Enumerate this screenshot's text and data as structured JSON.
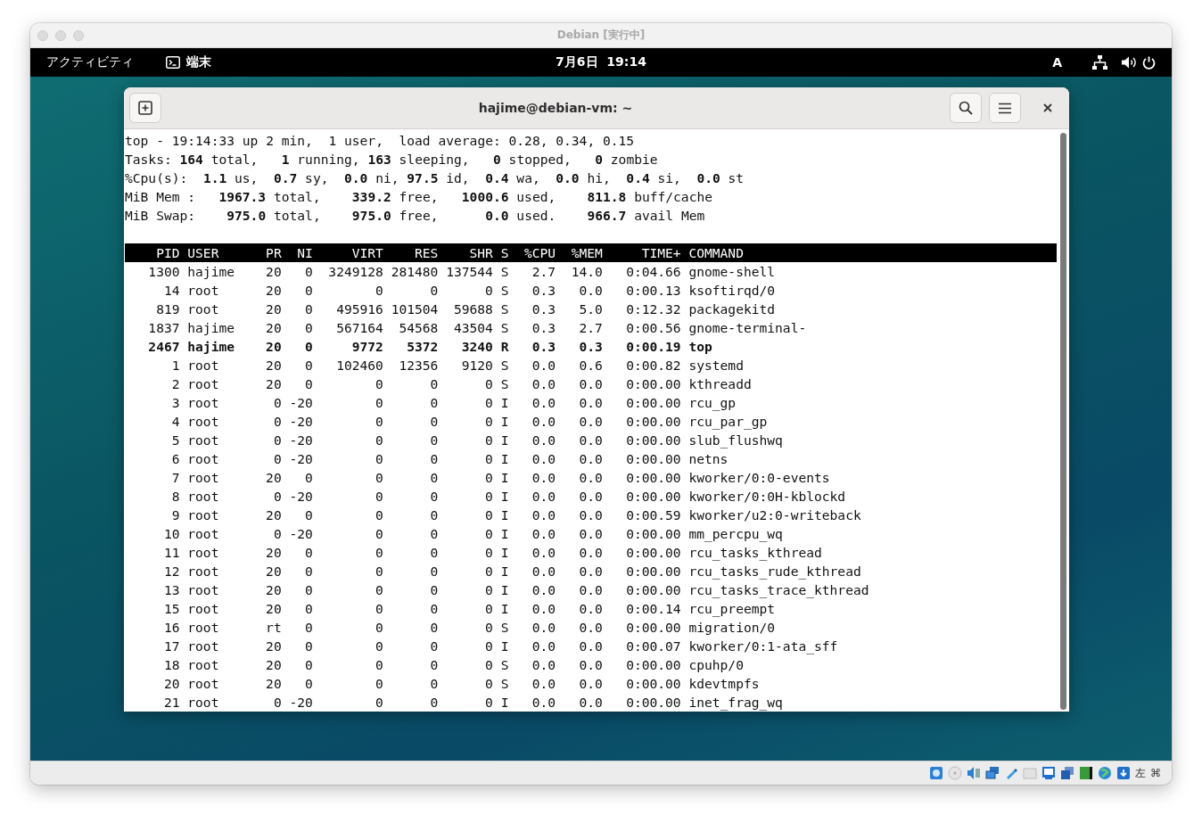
{
  "vm_window": {
    "title": "Debian [実行中]"
  },
  "top_bar": {
    "activities": "アクティビティ",
    "app": "端末",
    "clock": "7月6日  19:14",
    "input_method": "A"
  },
  "terminal": {
    "title": "hajime@debian-vm: ~",
    "summary": [
      "top - 19:14:33 up 2 min,  1 user,  load average: 0.28, 0.34, 0.15",
      "Tasks: **164** total,   **1** running, **163** sleeping,   **0** stopped,   **0** zombie",
      "%Cpu(s):  **1.1** us,  **0.7** sy,  **0.0** ni, **97.5** id,  **0.4** wa,  **0.0** hi,  **0.4** si,  **0.0** st",
      "MiB Mem :   **1967.3** total,    **339.2** free,   **1000.6** used,    **811.8** buff/cache",
      "MiB Swap:    **975.0** total,    **975.0** free,      **0.0** used.    **966.7** avail Mem"
    ],
    "columns": [
      "PID",
      "USER",
      "PR",
      "NI",
      "VIRT",
      "RES",
      "SHR",
      "S",
      "%CPU",
      "%MEM",
      "TIME+",
      "COMMAND"
    ],
    "rows": [
      {
        "cells": [
          "1300",
          "hajime",
          "20",
          "0",
          "3249128",
          "281480",
          "137544",
          "S",
          "2.7",
          "14.0",
          "0:04.66",
          "gnome-shell"
        ],
        "bold": false
      },
      {
        "cells": [
          "14",
          "root",
          "20",
          "0",
          "0",
          "0",
          "0",
          "S",
          "0.3",
          "0.0",
          "0:00.13",
          "ksoftirqd/0"
        ],
        "bold": false
      },
      {
        "cells": [
          "819",
          "root",
          "20",
          "0",
          "495916",
          "101504",
          "59688",
          "S",
          "0.3",
          "5.0",
          "0:12.32",
          "packagekitd"
        ],
        "bold": false
      },
      {
        "cells": [
          "1837",
          "hajime",
          "20",
          "0",
          "567164",
          "54568",
          "43504",
          "S",
          "0.3",
          "2.7",
          "0:00.56",
          "gnome-terminal-"
        ],
        "bold": false
      },
      {
        "cells": [
          "2467",
          "hajime",
          "20",
          "0",
          "9772",
          "5372",
          "3240",
          "R",
          "0.3",
          "0.3",
          "0:00.19",
          "top"
        ],
        "bold": true
      },
      {
        "cells": [
          "1",
          "root",
          "20",
          "0",
          "102460",
          "12356",
          "9120",
          "S",
          "0.0",
          "0.6",
          "0:00.82",
          "systemd"
        ],
        "bold": false
      },
      {
        "cells": [
          "2",
          "root",
          "20",
          "0",
          "0",
          "0",
          "0",
          "S",
          "0.0",
          "0.0",
          "0:00.00",
          "kthreadd"
        ],
        "bold": false
      },
      {
        "cells": [
          "3",
          "root",
          "0",
          "-20",
          "0",
          "0",
          "0",
          "I",
          "0.0",
          "0.0",
          "0:00.00",
          "rcu_gp"
        ],
        "bold": false
      },
      {
        "cells": [
          "4",
          "root",
          "0",
          "-20",
          "0",
          "0",
          "0",
          "I",
          "0.0",
          "0.0",
          "0:00.00",
          "rcu_par_gp"
        ],
        "bold": false
      },
      {
        "cells": [
          "5",
          "root",
          "0",
          "-20",
          "0",
          "0",
          "0",
          "I",
          "0.0",
          "0.0",
          "0:00.00",
          "slub_flushwq"
        ],
        "bold": false
      },
      {
        "cells": [
          "6",
          "root",
          "0",
          "-20",
          "0",
          "0",
          "0",
          "I",
          "0.0",
          "0.0",
          "0:00.00",
          "netns"
        ],
        "bold": false
      },
      {
        "cells": [
          "7",
          "root",
          "20",
          "0",
          "0",
          "0",
          "0",
          "I",
          "0.0",
          "0.0",
          "0:00.00",
          "kworker/0:0-events"
        ],
        "bold": false
      },
      {
        "cells": [
          "8",
          "root",
          "0",
          "-20",
          "0",
          "0",
          "0",
          "I",
          "0.0",
          "0.0",
          "0:00.00",
          "kworker/0:0H-kblockd"
        ],
        "bold": false
      },
      {
        "cells": [
          "9",
          "root",
          "20",
          "0",
          "0",
          "0",
          "0",
          "I",
          "0.0",
          "0.0",
          "0:00.59",
          "kworker/u2:0-writeback"
        ],
        "bold": false
      },
      {
        "cells": [
          "10",
          "root",
          "0",
          "-20",
          "0",
          "0",
          "0",
          "I",
          "0.0",
          "0.0",
          "0:00.00",
          "mm_percpu_wq"
        ],
        "bold": false
      },
      {
        "cells": [
          "11",
          "root",
          "20",
          "0",
          "0",
          "0",
          "0",
          "I",
          "0.0",
          "0.0",
          "0:00.00",
          "rcu_tasks_kthread"
        ],
        "bold": false
      },
      {
        "cells": [
          "12",
          "root",
          "20",
          "0",
          "0",
          "0",
          "0",
          "I",
          "0.0",
          "0.0",
          "0:00.00",
          "rcu_tasks_rude_kthread"
        ],
        "bold": false
      },
      {
        "cells": [
          "13",
          "root",
          "20",
          "0",
          "0",
          "0",
          "0",
          "I",
          "0.0",
          "0.0",
          "0:00.00",
          "rcu_tasks_trace_kthread"
        ],
        "bold": false
      },
      {
        "cells": [
          "15",
          "root",
          "20",
          "0",
          "0",
          "0",
          "0",
          "I",
          "0.0",
          "0.0",
          "0:00.14",
          "rcu_preempt"
        ],
        "bold": false
      },
      {
        "cells": [
          "16",
          "root",
          "rt",
          "0",
          "0",
          "0",
          "0",
          "S",
          "0.0",
          "0.0",
          "0:00.00",
          "migration/0"
        ],
        "bold": false
      },
      {
        "cells": [
          "17",
          "root",
          "20",
          "0",
          "0",
          "0",
          "0",
          "I",
          "0.0",
          "0.0",
          "0:00.07",
          "kworker/0:1-ata_sff"
        ],
        "bold": false
      },
      {
        "cells": [
          "18",
          "root",
          "20",
          "0",
          "0",
          "0",
          "0",
          "S",
          "0.0",
          "0.0",
          "0:00.00",
          "cpuhp/0"
        ],
        "bold": false
      },
      {
        "cells": [
          "20",
          "root",
          "20",
          "0",
          "0",
          "0",
          "0",
          "S",
          "0.0",
          "0.0",
          "0:00.00",
          "kdevtmpfs"
        ],
        "bold": false
      },
      {
        "cells": [
          "21",
          "root",
          "0",
          "-20",
          "0",
          "0",
          "0",
          "I",
          "0.0",
          "0.0",
          "0:00.00",
          "inet_frag_wq"
        ],
        "bold": false
      }
    ]
  },
  "status_bar": {
    "keys": [
      "左",
      "⌘"
    ]
  }
}
